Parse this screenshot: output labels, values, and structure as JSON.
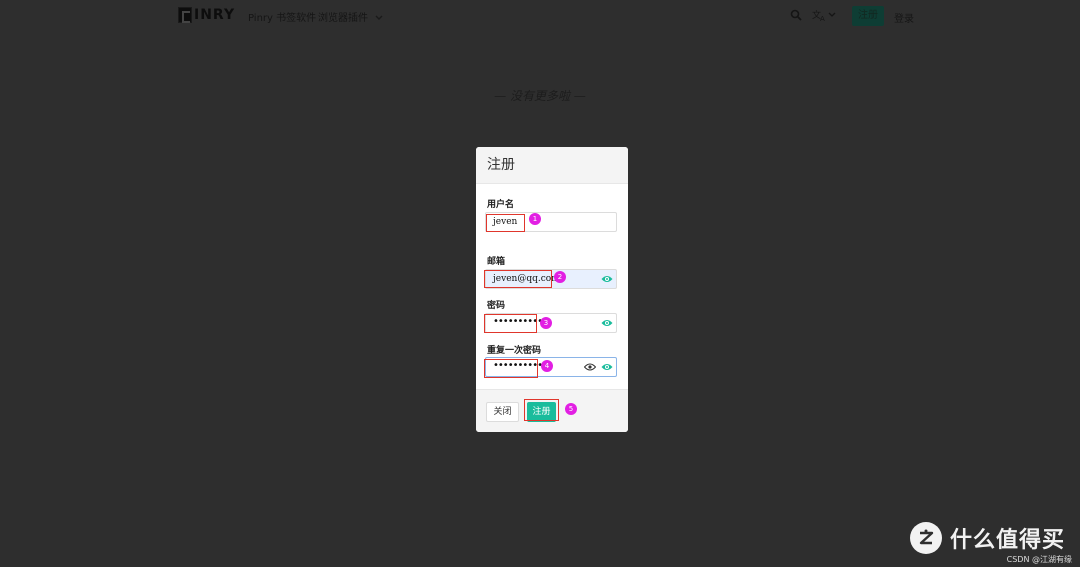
{
  "header": {
    "logo_text": "INRY",
    "nav": {
      "item1": "Pinry 书签软件",
      "item2": "浏览器插件"
    },
    "register_label": "注册",
    "login_label": "登录"
  },
  "feed": {
    "end_message": "— 没有更多啦 —"
  },
  "dialog": {
    "title": "注册",
    "username": {
      "label": "用户名",
      "value": "jeven"
    },
    "email": {
      "label": "邮箱",
      "value": "jeven@qq.com"
    },
    "password": {
      "label": "密码",
      "value": "••••••••••"
    },
    "confirm_password": {
      "label": "重复一次密码",
      "value": "••••••••••"
    },
    "close_label": "关闭",
    "submit_label": "注册"
  },
  "annotations": {
    "step1": "1",
    "step2": "2",
    "step3": "3",
    "step4": "4",
    "step5": "5",
    "highlight_color": "#e0362c",
    "badge_color": "#e21fe3"
  },
  "colors": {
    "accent": "#1abc9c",
    "overlay": "#2e2e2e"
  },
  "watermark": {
    "brand": "什么值得买",
    "brand_icon": "zhi-logo-icon",
    "source": "CSDN @江湖有缘"
  }
}
